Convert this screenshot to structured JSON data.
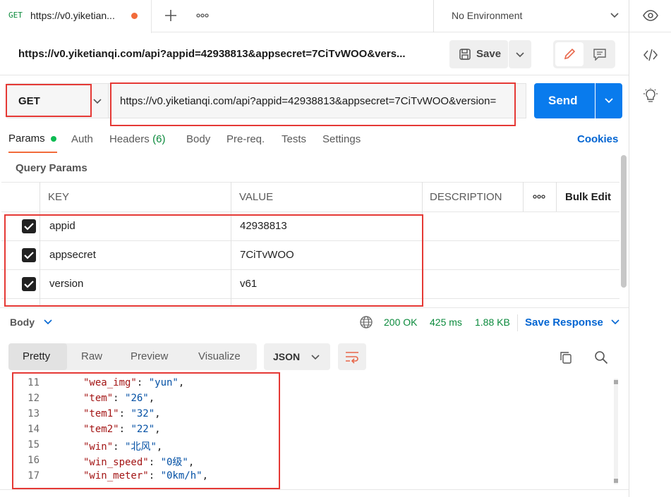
{
  "tab": {
    "method": "GET",
    "title": "https://v0.yiketian..."
  },
  "environment": {
    "label": "No Environment"
  },
  "request_title": "https://v0.yiketianqi.com/api?appid=42938813&appsecret=7CiTvWOO&vers...",
  "save_label": "Save",
  "method": "GET",
  "url": "https://v0.yiketianqi.com/api?appid=42938813&appsecret=7CiTvWOO&version=",
  "send_label": "Send",
  "req_tabs": [
    {
      "label": "Params"
    },
    {
      "label": "Auth"
    },
    {
      "label": "Headers",
      "count": "(6)"
    },
    {
      "label": "Body"
    },
    {
      "label": "Pre-req."
    },
    {
      "label": "Tests"
    },
    {
      "label": "Settings"
    }
  ],
  "cookies_label": "Cookies",
  "query_params_title": "Query Params",
  "table": {
    "headers": {
      "key": "KEY",
      "value": "VALUE",
      "description": "DESCRIPTION",
      "bulk_edit": "Bulk Edit"
    },
    "rows": [
      {
        "key": "appid",
        "value": "42938813"
      },
      {
        "key": "appsecret",
        "value": "7CiTvWOO"
      },
      {
        "key": "version",
        "value": "v61"
      }
    ]
  },
  "response": {
    "body_label": "Body",
    "status": "200 OK",
    "time": "425 ms",
    "size": "1.88 KB",
    "save_response": "Save Response",
    "view_tabs": [
      {
        "label": "Pretty"
      },
      {
        "label": "Raw"
      },
      {
        "label": "Preview"
      },
      {
        "label": "Visualize"
      }
    ],
    "format": "JSON",
    "lines": [
      {
        "n": "11",
        "k": "\"wea_img\"",
        "v": "\"yun\""
      },
      {
        "n": "12",
        "k": "\"tem\"",
        "v": "\"26\""
      },
      {
        "n": "13",
        "k": "\"tem1\"",
        "v": "\"32\""
      },
      {
        "n": "14",
        "k": "\"tem2\"",
        "v": "\"22\""
      },
      {
        "n": "15",
        "k": "\"win\"",
        "v": "\"北风\""
      },
      {
        "n": "16",
        "k": "\"win_speed\"",
        "v": "\"0级\""
      },
      {
        "n": "17",
        "k": "\"win_meter\"",
        "v": "\"0km/h\""
      }
    ]
  },
  "colors": {
    "accent": "#0265d2",
    "send": "#097bed",
    "status_ok": "#0b8a3c",
    "annotation": "#e53935"
  }
}
